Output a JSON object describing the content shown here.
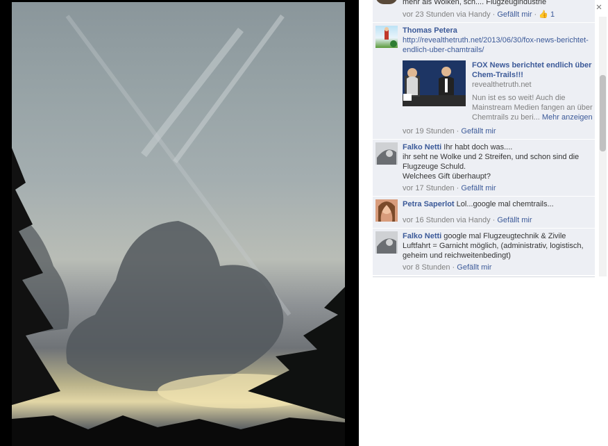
{
  "window": {
    "close_glyph": "×"
  },
  "photo": {
    "description_icon": "sky-photo"
  },
  "comments": [
    {
      "id": "c0",
      "partial_text": "mehr als Wolken, sch.... Flugzeugindustrie",
      "time": "vor 23 Stunden via Handy",
      "like_label": "Gefällt mir",
      "like_count": "1"
    },
    {
      "id": "c1",
      "author": "Thomas Petera",
      "link_text": "http://revealthetruth.net/2013/06/30/fox-news-berichtet-endlich-uber-chamtrails/",
      "share": {
        "title": "FOX News berichtet endlich über Chem-Trails!!!",
        "domain": "revealthetruth.net",
        "description": "Nun ist es so weit! Auch die Mainstream Medien fangen an über Chemtrails zu beri...",
        "more_label": "Mehr anzeigen"
      },
      "time": "vor 19 Stunden",
      "like_label": "Gefällt mir"
    },
    {
      "id": "c2",
      "author": "Falko Netti",
      "text_lines": [
        "Ihr habt doch was....",
        "ihr seht ne Wolke und 2 Streifen, und schon sind die Flugzeuge Schuld.",
        "Welchees Gift überhaupt?"
      ],
      "time": "vor 17 Stunden",
      "like_label": "Gefällt mir"
    },
    {
      "id": "c3",
      "author": "Petra Saperlot",
      "text": "Lol...google mal chemtrails...",
      "time": "vor 16 Stunden via Handy",
      "like_label": "Gefällt mir"
    },
    {
      "id": "c4",
      "author": "Falko Netti",
      "text": "google mal Flugzeugtechnik & Zivile Luftfahrt = Garnicht möglich, (administrativ, logistisch, geheim und reichweitenbedingt)",
      "time": "vor 8 Stunden",
      "like_label": "Gefällt mir"
    }
  ],
  "separator": " · "
}
